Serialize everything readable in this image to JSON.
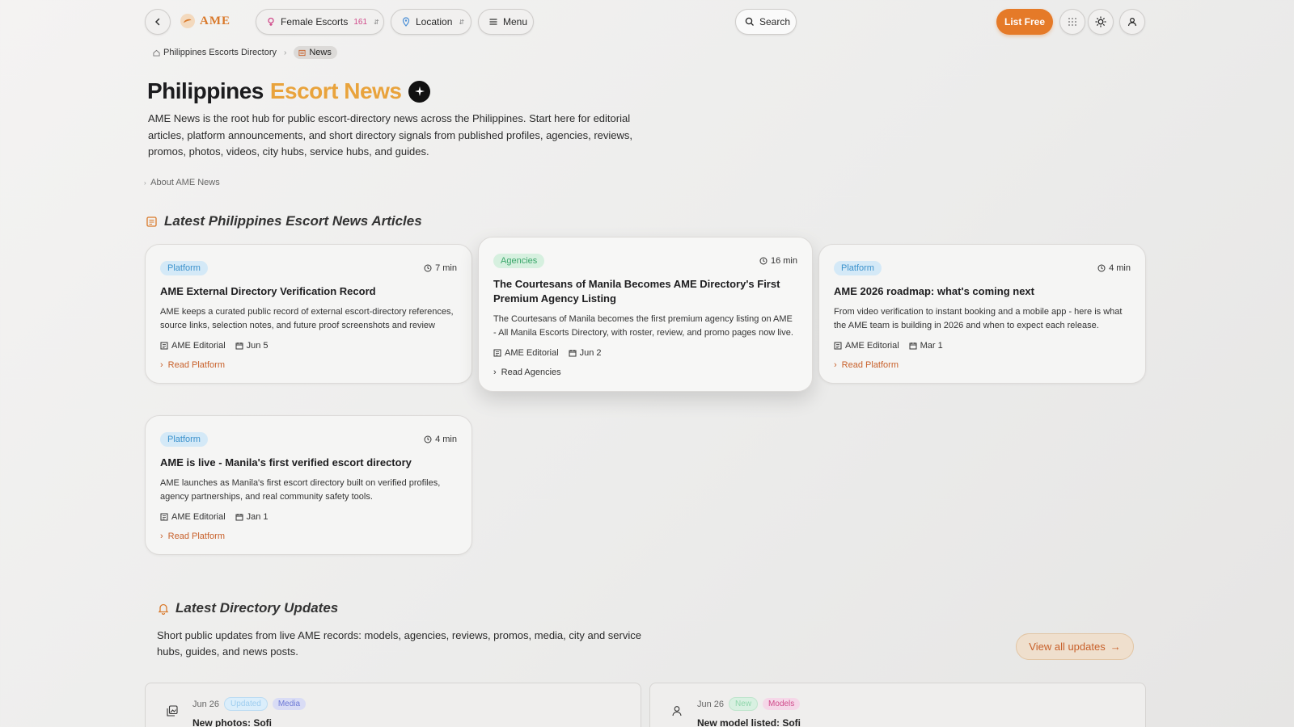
{
  "header": {
    "brand": "AME",
    "category_label": "Female Escorts",
    "category_count": "161",
    "location_label": "Location",
    "menu_label": "Menu",
    "search_label": "Search",
    "list_free_label": "List Free"
  },
  "breadcrumb": {
    "home": "Philippines Escorts Directory",
    "current": "News"
  },
  "page": {
    "title_main": "Philippines",
    "title_accent": "Escort News",
    "intro": "AME News is the root hub for public escort-directory news across the Philippines. Start here for editorial articles, platform announcements, and short directory signals from published profiles, agencies, reviews, promos, photos, videos, city hubs, service hubs, and guides.",
    "about_link": "About AME News"
  },
  "articles_section": {
    "heading": "Latest Philippines Escort News Articles",
    "articles": [
      {
        "tag": "Platform",
        "minutes": "7 min",
        "title": "AME External Directory Verification Record",
        "desc": "AME keeps a curated public record of external escort-directory references, source links, selection notes, and future proof screenshots and review context.",
        "author": "AME Editorial",
        "date": "Jun 5",
        "read": "Read Platform"
      },
      {
        "tag": "Agencies",
        "minutes": "16 min",
        "title": "The Courtesans of Manila Becomes AME Directory's First Premium Agency Listing",
        "desc": "The Courtesans of Manila becomes the first premium agency listing on AME - All Manila Escorts Directory, with roster, review, and promo pages now live.",
        "author": "AME Editorial",
        "date": "Jun 2",
        "read": "Read Agencies"
      },
      {
        "tag": "Platform",
        "minutes": "4 min",
        "title": "AME 2026 roadmap: what's coming next",
        "desc": "From video verification to instant booking and a mobile app - here is what the AME team is building in 2026 and when to expect each release.",
        "author": "AME Editorial",
        "date": "Mar 1",
        "read": "Read Platform"
      },
      {
        "tag": "Platform",
        "minutes": "4 min",
        "title": "AME is live - Manila's first verified escort directory",
        "desc": "AME launches as Manila's first escort directory built on verified profiles, agency partnerships, and real community safety tools.",
        "author": "AME Editorial",
        "date": "Jan 1",
        "read": "Read Platform"
      }
    ]
  },
  "updates_section": {
    "heading": "Latest Directory Updates",
    "desc": "Short public updates from live AME records: models, agencies, reviews, promos, media, city and service hubs, guides, and news posts.",
    "view_all": "View all updates",
    "items": [
      {
        "date": "Jun 26",
        "status": "Updated",
        "kind": "Media",
        "title": "New photos: Sofi"
      },
      {
        "date": "Jun 26",
        "status": "New",
        "kind": "Models",
        "title": "New model listed: Sofi"
      }
    ]
  },
  "colors": {
    "accent": "#e57a28",
    "title_accent": "#e9a33c",
    "platform_tag": "#3c92cc",
    "agencies_tag": "#3aa66a"
  }
}
